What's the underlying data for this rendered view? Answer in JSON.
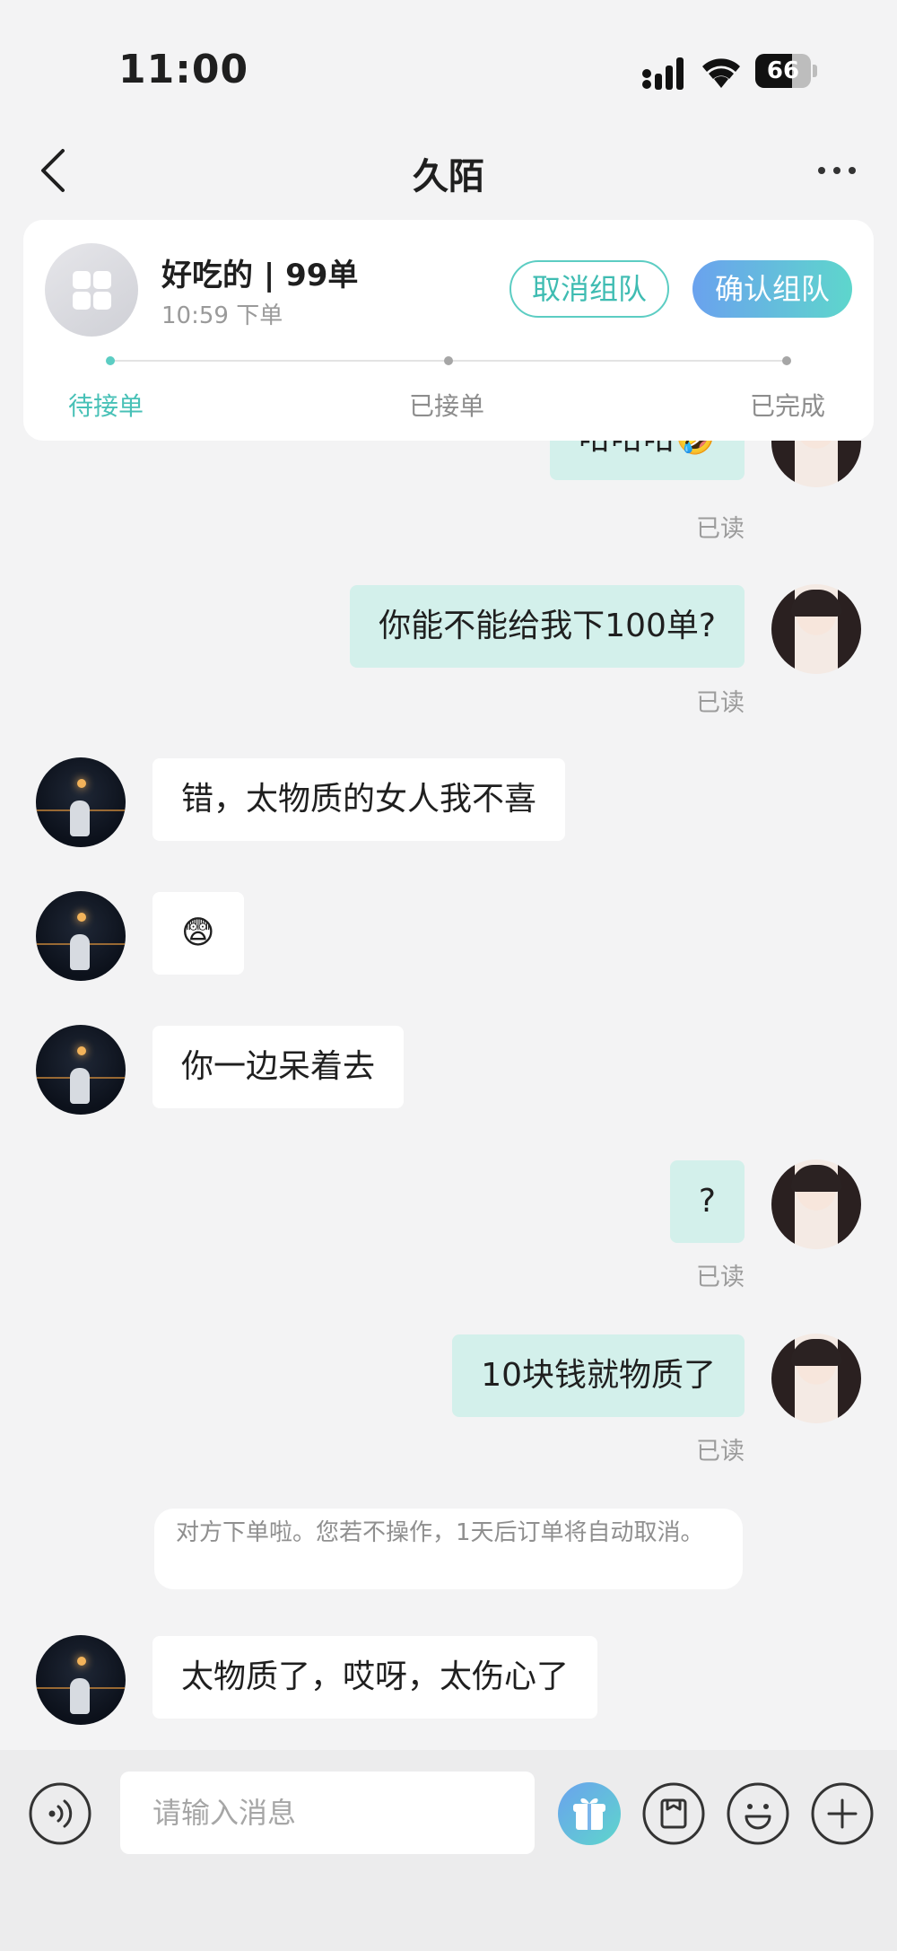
{
  "status_bar": {
    "time": "11:00",
    "battery": "66",
    "battery_level": 0.66
  },
  "nav": {
    "title": "久陌"
  },
  "order": {
    "title": "好吃的 | 99单",
    "time": "10:59 下单",
    "cancel_label": "取消组队",
    "confirm_label": "确认组队",
    "steps": [
      "待接单",
      "已接单",
      "已完成"
    ],
    "active_step": 0
  },
  "messages": [
    {
      "side": "self",
      "text": "哈哈哈🤣",
      "read": "已读"
    },
    {
      "side": "self",
      "text": "你能不能给我下100单?",
      "read": "已读"
    },
    {
      "side": "other",
      "text": "错，太物质的女人我不喜"
    },
    {
      "side": "other",
      "text": "😨"
    },
    {
      "side": "other",
      "text": "你一边呆着去"
    },
    {
      "side": "self",
      "text": "?",
      "read": "已读"
    },
    {
      "side": "self",
      "text": "10块钱就物质了",
      "read": "已读"
    },
    {
      "side": "other",
      "text": "太物质了，哎呀，太伤心了"
    }
  ],
  "system_note": "对方下单啦。您若不操作，1天后订单将自动取消。",
  "input": {
    "placeholder": "请输入消息"
  },
  "colors": {
    "accent": "#5ccdc3",
    "self_bubble": "#d3f0eb",
    "gift_gradient": [
      "#6aa2ee",
      "#5ed6cc"
    ]
  },
  "icons": [
    "back-icon",
    "more-icon",
    "voice-icon",
    "gift-icon",
    "order-icon",
    "emoji-icon",
    "plus-icon"
  ]
}
